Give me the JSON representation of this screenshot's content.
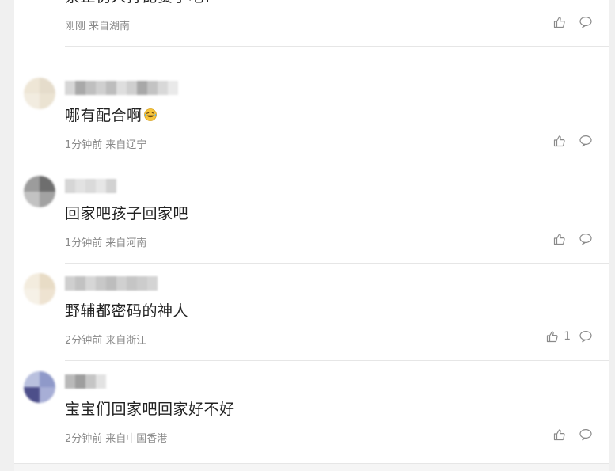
{
  "comments": [
    {
      "text": "禁止伪人打比赛了吧?",
      "time": "刚刚",
      "location": "来自湖南",
      "likes": "",
      "avatar": [
        "#a89c98",
        "#7a6e6a",
        "#ddd7d4",
        "#c7bfbc"
      ],
      "name_blocks": [
        "#c9c9c9",
        "#dcdcdc",
        "#cfcfcf"
      ]
    },
    {
      "text": "哪有配合啊",
      "emoji": "laughing-tears-emoji",
      "time": "1分钟前",
      "location": "来自辽宁",
      "likes": "",
      "avatar": [
        "#eee6d6",
        "#e5dccb",
        "#f2ece0",
        "#ebe3d2"
      ],
      "name_blocks": [
        "#d6d6d6",
        "#a9a9a9",
        "#bfbfbf",
        "#cfcfcf",
        "#bdbdbd",
        "#dedede",
        "#cfcfcf",
        "#a8a8a8",
        "#c3c3c3",
        "#d8d8d8",
        "#e9e9e9"
      ]
    },
    {
      "text": "回家吧孩子回家吧",
      "time": "1分钟前",
      "location": "来自河南",
      "likes": "",
      "avatar": [
        "#9c9c9c",
        "#6e6e6e",
        "#c2c2c2",
        "#a2a2a2"
      ],
      "name_blocks": [
        "#d6d6d6",
        "#e2e2e2",
        "#dadada",
        "#e6e6e6",
        "#d2d2d2"
      ]
    },
    {
      "text": "野辅都密码的神人",
      "time": "2分钟前",
      "location": "来自浙江",
      "likes": "1",
      "avatar": [
        "#f3ecde",
        "#e8dcc6",
        "#f6f1e7",
        "#eee3d1"
      ],
      "name_blocks": [
        "#cfcfcf",
        "#c2c2c2",
        "#d6d6d6",
        "#c8c8c8",
        "#bdbdbd",
        "#d0d0d0",
        "#c5c5c5",
        "#cccccc",
        "#d4d4d4"
      ]
    },
    {
      "text": "宝宝们回家吧回家好不好",
      "time": "2分钟前",
      "location": "来自中国香港",
      "likes": "",
      "avatar": [
        "#b9c0de",
        "#8f99c9",
        "#4d4f8a",
        "#a7aed6"
      ],
      "name_blocks": [
        "#b9b9b9",
        "#9e9e9e",
        "#c5c5c5",
        "#e2e2e2"
      ]
    }
  ],
  "colors": {
    "text": "#222222",
    "meta": "#8a8a8a",
    "divider": "#e6e6e6",
    "background": "#f0f0f0"
  },
  "icons": {
    "like": "thumbs-up-icon",
    "reply": "comment-bubble-icon"
  }
}
